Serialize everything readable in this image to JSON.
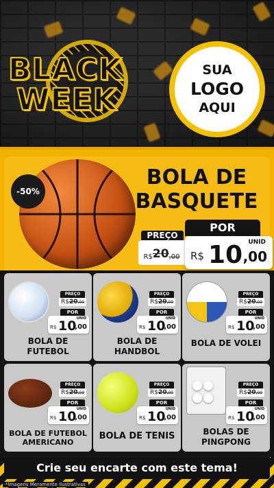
{
  "brand": {
    "line1": "BLACK",
    "line2": "WEEK"
  },
  "logo": {
    "line1": "SUA",
    "line2": "LOGO",
    "line3": "AQUI"
  },
  "colors": {
    "accent": "#f2c200",
    "dark": "#141414",
    "card": "#c9c9c9"
  },
  "featured": {
    "discount": "-50%",
    "title_line1": "BOLA DE",
    "title_line2": "BASQUETE",
    "por_label": "POR",
    "preco_label": "PREÇO",
    "old_currency": "R$",
    "old_value": "20",
    "old_cents": ",00",
    "new_unit": "UNID",
    "new_currency": "R$",
    "new_value": "10",
    "new_cents": ",00",
    "icon": "basketball-icon"
  },
  "price_tags": {
    "preco": "PREÇO",
    "por": "POR",
    "unid": "UNID",
    "old_currency": "R$",
    "old_value": "20",
    "old_cents": ",00",
    "new_currency": "R$",
    "new_value": "10",
    "new_cents": ",00"
  },
  "products": [
    {
      "line1": "BOLA DE",
      "line2": "FUTEBOL",
      "icon": "soccer-ball-icon"
    },
    {
      "line1": "BOLA DE",
      "line2": "HANDBOL",
      "icon": "handball-icon"
    },
    {
      "line1": "BOLA DE VOLEI",
      "line2": "",
      "icon": "volleyball-icon"
    },
    {
      "line1": "BOLA DE FUTEBOL",
      "line2": "AMERICANO",
      "icon": "american-football-icon"
    },
    {
      "line1": "BOLA DE TENIS",
      "line2": "",
      "icon": "tennis-ball-icon"
    },
    {
      "line1": "BOLAS DE",
      "line2": "PINGPONG",
      "icon": "pingpong-balls-icon"
    }
  ],
  "cta": {
    "label": "Crie seu encarte com este tema!"
  },
  "disclaimer": "*Imagens Meramente Ilustrativas"
}
